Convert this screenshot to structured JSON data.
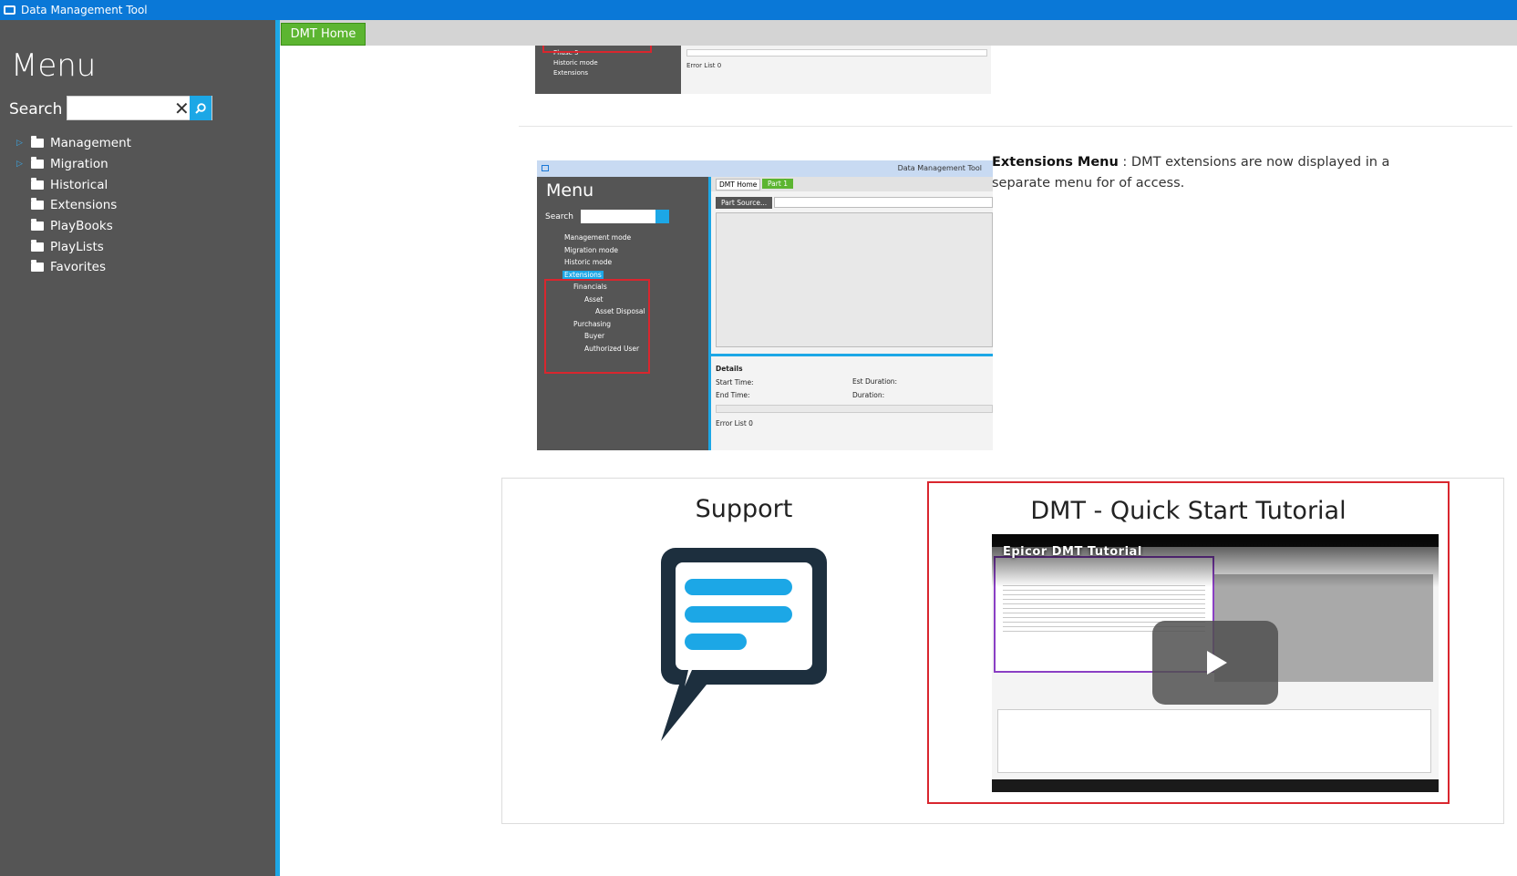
{
  "window": {
    "title": "Data Management Tool"
  },
  "sidebar": {
    "title": "Menu",
    "search_label": "Search",
    "search_value": "",
    "items": [
      {
        "label": "Management",
        "expandable": true
      },
      {
        "label": "Migration",
        "expandable": true
      },
      {
        "label": "Historical",
        "expandable": false
      },
      {
        "label": "Extensions",
        "expandable": false
      },
      {
        "label": "PlayBooks",
        "expandable": false
      },
      {
        "label": "PlayLists",
        "expandable": false
      },
      {
        "label": "Favorites",
        "expandable": false
      }
    ]
  },
  "tabs": {
    "home_label": "DMT Home"
  },
  "top_thumb": {
    "items": [
      "Phase 5",
      "Historic mode",
      "Extensions"
    ],
    "error_list": "Error List   0"
  },
  "extensions_shot": {
    "title": "Data Management Tool",
    "menu": "Menu",
    "search": "Search",
    "tree": [
      "Management mode",
      "Migration mode",
      "Historic mode",
      "Extensions",
      "Financials",
      "Asset",
      "Asset Disposal",
      "Purchasing",
      "Buyer",
      "Authorized User"
    ],
    "tab1": "DMT Home",
    "tab2": "Part 1",
    "button": "Part Source...",
    "details": "Details",
    "start_time": "Start Time:",
    "end_time": "End Time:",
    "est_duration": "Est Duration:",
    "duration": "Duration:",
    "error_list": "Error List   0"
  },
  "extensions_desc": {
    "bold": "Extensions Menu",
    "text": " : DMT extensions are now displayed in a separate menu for of access."
  },
  "support": {
    "title": "Support",
    "icon": "chat-bubble-icon"
  },
  "tutorial": {
    "title": "DMT - Quick Start Tutorial",
    "video_caption": "Epicor DMT Tutorial"
  },
  "colors": {
    "accent": "#1ca7e6",
    "titlebar": "#0a78d7",
    "sidebar": "#555555",
    "tab_green": "#5cb531",
    "highlight_red": "#d9262e"
  }
}
